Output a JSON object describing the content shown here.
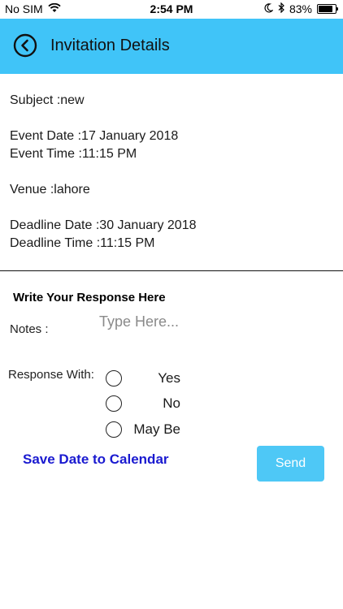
{
  "status_bar": {
    "carrier": "No SIM",
    "time": "2:54 PM",
    "battery_text": "83%",
    "battery_level": 0.83
  },
  "header": {
    "title": "Invitation Details",
    "bg_color": "#40c4f8"
  },
  "details": {
    "subject": "Subject :new",
    "event_date": "Event Date :17 January 2018",
    "event_time": "Event Time :11:15 PM",
    "venue": "Venue :lahore",
    "deadline_date": "Deadline Date :30 January 2018",
    "deadline_time": "Deadline Time :11:15 PM"
  },
  "response": {
    "heading": "Write Your Response Here",
    "notes_label": "Notes :",
    "notes_placeholder": "Type Here...",
    "notes_value": "",
    "response_label": "Response With:",
    "options": [
      "Yes",
      "No",
      "May Be"
    ]
  },
  "actions": {
    "save_calendar": "Save Date to Calendar",
    "send": "Send"
  },
  "icons": {
    "back": "back-arrow-circle-icon",
    "wifi": "wifi-icon",
    "moon": "moon-icon",
    "bluetooth": "bluetooth-icon",
    "battery": "battery-icon"
  }
}
